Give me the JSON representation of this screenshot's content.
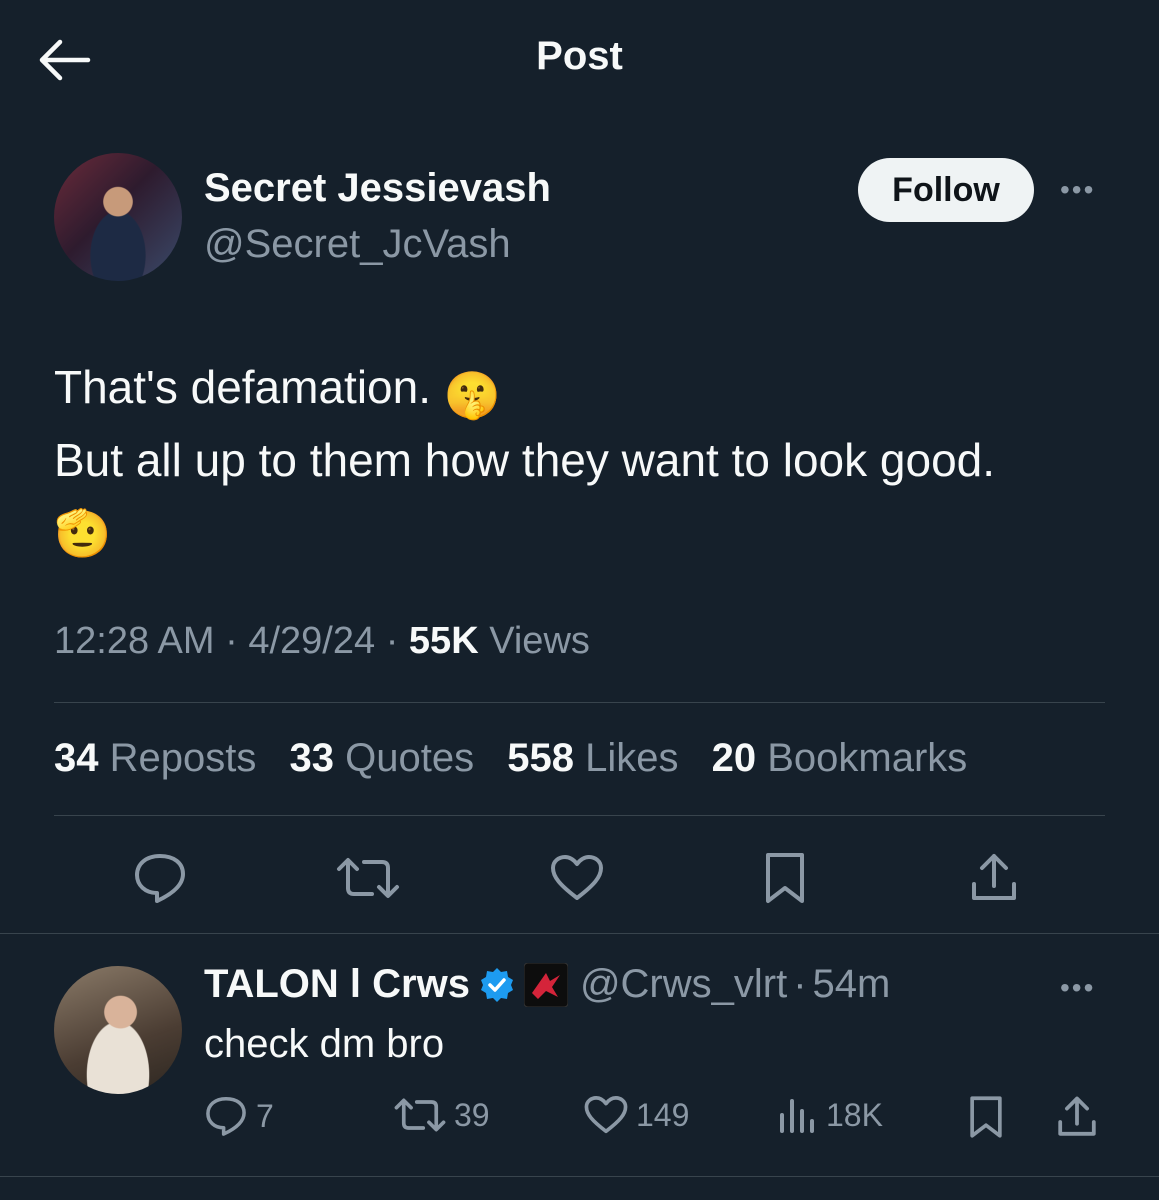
{
  "header": {
    "title": "Post"
  },
  "post": {
    "author_name": "Secret Jessievash",
    "author_handle": "@Secret_JcVash",
    "follow_label": "Follow",
    "more_label": "•••",
    "text_line1": "That's defamation.",
    "text_line2": "But all up to them how they want to look good.",
    "emoji1": "🤫",
    "emoji2": "🫡",
    "time": "12:28 AM",
    "date": "4/29/24",
    "views_count": "55K",
    "views_label": "Views",
    "sep": "·",
    "stats": {
      "reposts_count": "34",
      "reposts_label": "Reposts",
      "quotes_count": "33",
      "quotes_label": "Quotes",
      "likes_count": "558",
      "likes_label": "Likes",
      "bookmarks_count": "20",
      "bookmarks_label": "Bookmarks"
    }
  },
  "reply": {
    "author_name": "TALON l Crws",
    "author_handle": "@Crws_vlrt",
    "time": "54m",
    "sep": "·",
    "more_label": "•••",
    "text": "check dm bro",
    "replies": "7",
    "reposts": "39",
    "likes": "149",
    "views": "18K"
  },
  "colors": {
    "background": "#15202b",
    "muted": "#8b98a5",
    "verified": "#1d9bf0",
    "text": "#f7f9f9"
  }
}
